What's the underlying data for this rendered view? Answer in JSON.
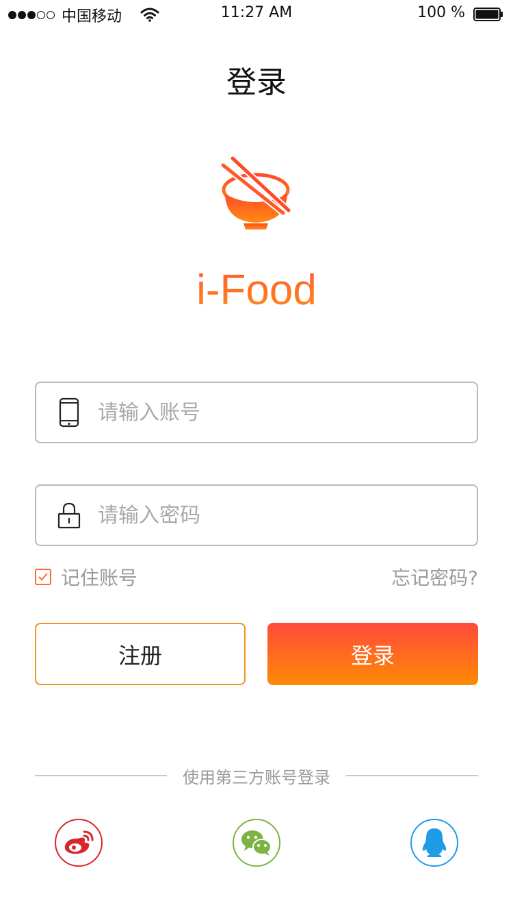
{
  "status_bar": {
    "carrier": "中国移动",
    "time": "11:27 AM",
    "battery": "100 %",
    "signal_filled": 3,
    "signal_total": 5
  },
  "header": {
    "title": "登录"
  },
  "brand": {
    "name": "i-Food",
    "logo_icon": "bowl-chopsticks-icon",
    "accent_start": "#ff4a3a",
    "accent_end": "#ff8a05"
  },
  "form": {
    "account": {
      "placeholder": "请输入账号",
      "value": "",
      "icon": "phone-icon"
    },
    "password": {
      "placeholder": "请输入密码",
      "value": "",
      "icon": "lock-icon"
    },
    "remember": {
      "label": "记住账号",
      "checked": true
    },
    "forgot_label": "忘记密码?"
  },
  "buttons": {
    "register": "注册",
    "login": "登录"
  },
  "third_party": {
    "title": "使用第三方账号登录",
    "providers": [
      {
        "name": "weibo",
        "icon": "weibo-icon",
        "color": "#d9262b"
      },
      {
        "name": "wechat",
        "icon": "wechat-icon",
        "color": "#7cb342"
      },
      {
        "name": "qq",
        "icon": "qq-icon",
        "color": "#1f9be8"
      }
    ]
  }
}
